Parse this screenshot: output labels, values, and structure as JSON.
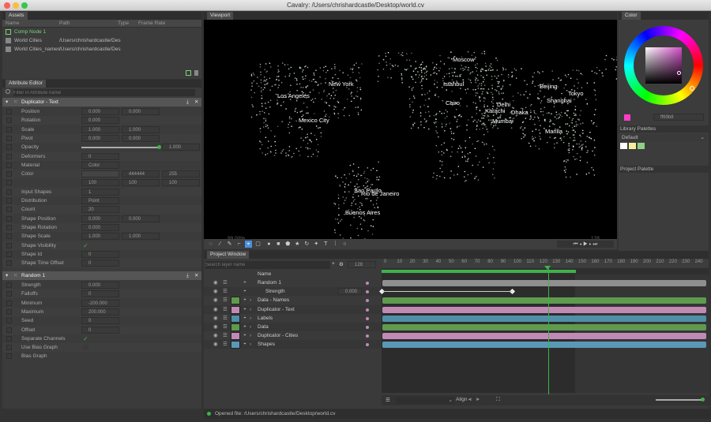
{
  "window": {
    "title": "Cavalry: /Users/chrishardcastle/Desktop/world.cv"
  },
  "assets": {
    "tab": "Assets",
    "columns": [
      "Name",
      "Path",
      "Type",
      "Frame Rate"
    ],
    "items": [
      {
        "name": "Comp Node 1",
        "path": "",
        "selected": true
      },
      {
        "name": "World Cities",
        "path": "/Users/chrishardcastle/Des"
      },
      {
        "name": "World Cities_names",
        "path": "/Users/chrishardcastle/Des"
      }
    ]
  },
  "attr": {
    "tab": "Attribute Editor",
    "filter_placeholder": "Filter in Attribute name",
    "dup_title": "Duplicator - Text",
    "dup_rows": [
      {
        "l": "Position",
        "a": "0.000",
        "b": "0.000"
      },
      {
        "l": "Rotation",
        "a": "0.000",
        "b": ""
      },
      {
        "l": "Scale",
        "a": "1.000",
        "b": "1.000"
      },
      {
        "l": "Pivot",
        "a": "0.000",
        "b": "0.000"
      },
      {
        "l": "Opacity",
        "a": "",
        "b": "1.000"
      },
      {
        "l": "Deformers",
        "a": "0",
        "b": ""
      },
      {
        "l": "Material",
        "a": "Color",
        "b": ""
      },
      {
        "l": "Color",
        "a": "",
        "b": ""
      },
      {
        "l": "",
        "a": "",
        "b": ""
      },
      {
        "l": "Input Shapes",
        "a": "1",
        "b": ""
      },
      {
        "l": "Distribution",
        "a": "Point",
        "b": ""
      },
      {
        "l": "Count",
        "a": "20",
        "b": ""
      },
      {
        "l": "Shape Position",
        "a": "0.000",
        "b": "0.000"
      },
      {
        "l": "Shape Rotation",
        "a": "0.000",
        "b": ""
      },
      {
        "l": "Shape Scale",
        "a": "1.000",
        "b": "1.000"
      },
      {
        "l": "Shape Visibility",
        "a": "",
        "b": ""
      },
      {
        "l": "Shape Id",
        "a": "0",
        "b": ""
      },
      {
        "l": "Shape Time Offset",
        "a": "0",
        "b": ""
      }
    ],
    "color_vals": [
      "444444",
      "255",
      "100",
      "100",
      "100"
    ],
    "rand_title": "Random 1",
    "rand_rows": [
      {
        "l": "Strength",
        "a": "0.000"
      },
      {
        "l": "Falloffs",
        "a": "0"
      },
      {
        "l": "Minimum",
        "a": "-200.000"
      },
      {
        "l": "Maximum",
        "a": "200.000"
      },
      {
        "l": "Seed",
        "a": "0"
      },
      {
        "l": "Offset",
        "a": "0"
      },
      {
        "l": "Separate Channels",
        "a": ""
      },
      {
        "l": "Use Bias Graph",
        "a": ""
      },
      {
        "l": "Bias Graph",
        "a": ""
      }
    ]
  },
  "viewport": {
    "tab": "Viewport",
    "zoom": "99.00%",
    "frame": "128",
    "cities": [
      "Moscow",
      "New York",
      "Los Angeles",
      "Istanbul",
      "Beijing",
      "Tokyo",
      "Shanghai",
      "Cairo",
      "Delhi",
      "Karachi",
      "Dhaka",
      "Mumbai",
      "Mexico City",
      "Manila",
      "Sao Paulo",
      "Rio de Janeiro",
      "Buenos Aires"
    ]
  },
  "color": {
    "tab": "Color",
    "hex": "ff69b8",
    "library": "Library Palettes",
    "palette_default": "Default",
    "project": "Project Palette",
    "swatches": [
      "#ffffff",
      "#f4ef9a",
      "#8fd184"
    ]
  },
  "project": {
    "tab": "Project Window",
    "search_placeholder": "Search layer name",
    "frame": "128",
    "name_col": "Name",
    "layers": [
      {
        "name": "Random 1",
        "indent": 1,
        "color": ""
      },
      {
        "name": "Strength",
        "indent": 2,
        "color": "",
        "value": "0.000"
      },
      {
        "name": "Data - Names",
        "indent": 0,
        "color": "#5f9a4f"
      },
      {
        "name": "Duplicator - Text",
        "indent": 0,
        "color": "#c08ab5"
      },
      {
        "name": "Labels",
        "indent": 0,
        "color": "#4f8fa8"
      },
      {
        "name": "Data",
        "indent": 0,
        "color": "#5f9a4f"
      },
      {
        "name": "Duplicator - Cities",
        "indent": 0,
        "color": "#c08ab5"
      },
      {
        "name": "Shapes",
        "indent": 0,
        "color": "#5a98b5"
      }
    ],
    "ticks": [
      "0",
      "10",
      "20",
      "30",
      "40",
      "50",
      "60",
      "70",
      "80",
      "90",
      "100",
      "110",
      "120",
      "130",
      "140",
      "150",
      "160",
      "170",
      "180",
      "190",
      "200",
      "210",
      "220",
      "230",
      "240"
    ],
    "align": "Align"
  },
  "status": {
    "text": "Opened file: /Users/chrishardcastle/Desktop/world.cv"
  }
}
